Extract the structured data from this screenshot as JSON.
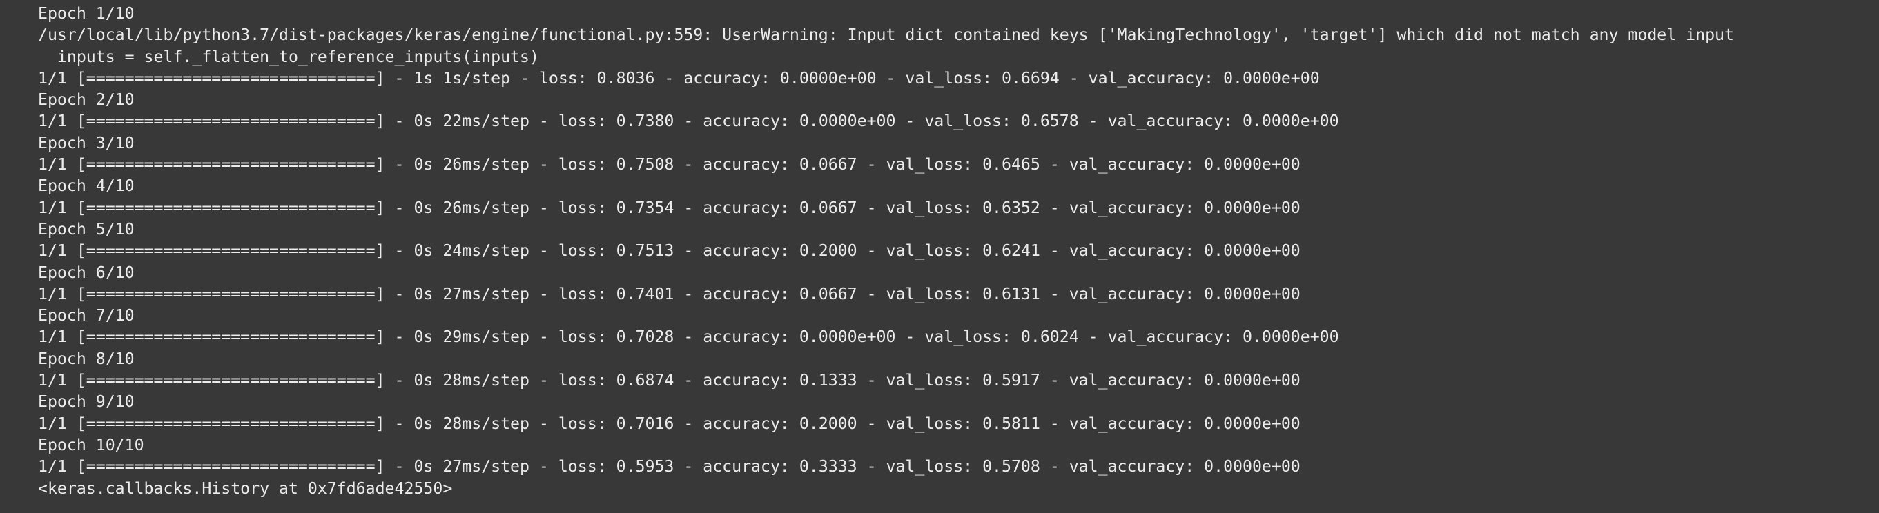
{
  "output": {
    "lines": [
      "Epoch 1/10",
      "/usr/local/lib/python3.7/dist-packages/keras/engine/functional.py:559: UserWarning: Input dict contained keys ['MakingTechnology', 'target'] which did not match any model input",
      "  inputs = self._flatten_to_reference_inputs(inputs)",
      "1/1 [==============================] - 1s 1s/step - loss: 0.8036 - accuracy: 0.0000e+00 - val_loss: 0.6694 - val_accuracy: 0.0000e+00",
      "Epoch 2/10",
      "1/1 [==============================] - 0s 22ms/step - loss: 0.7380 - accuracy: 0.0000e+00 - val_loss: 0.6578 - val_accuracy: 0.0000e+00",
      "Epoch 3/10",
      "1/1 [==============================] - 0s 26ms/step - loss: 0.7508 - accuracy: 0.0667 - val_loss: 0.6465 - val_accuracy: 0.0000e+00",
      "Epoch 4/10",
      "1/1 [==============================] - 0s 26ms/step - loss: 0.7354 - accuracy: 0.0667 - val_loss: 0.6352 - val_accuracy: 0.0000e+00",
      "Epoch 5/10",
      "1/1 [==============================] - 0s 24ms/step - loss: 0.7513 - accuracy: 0.2000 - val_loss: 0.6241 - val_accuracy: 0.0000e+00",
      "Epoch 6/10",
      "1/1 [==============================] - 0s 27ms/step - loss: 0.7401 - accuracy: 0.0667 - val_loss: 0.6131 - val_accuracy: 0.0000e+00",
      "Epoch 7/10",
      "1/1 [==============================] - 0s 29ms/step - loss: 0.7028 - accuracy: 0.0000e+00 - val_loss: 0.6024 - val_accuracy: 0.0000e+00",
      "Epoch 8/10",
      "1/1 [==============================] - 0s 28ms/step - loss: 0.6874 - accuracy: 0.1333 - val_loss: 0.5917 - val_accuracy: 0.0000e+00",
      "Epoch 9/10",
      "1/1 [==============================] - 0s 28ms/step - loss: 0.7016 - accuracy: 0.2000 - val_loss: 0.5811 - val_accuracy: 0.0000e+00",
      "Epoch 10/10",
      "1/1 [==============================] - 0s 27ms/step - loss: 0.5953 - accuracy: 0.3333 - val_loss: 0.5708 - val_accuracy: 0.0000e+00",
      "<keras.callbacks.History at 0x7fd6ade42550>"
    ]
  },
  "colors": {
    "background": "#383838",
    "text": "#ececec"
  }
}
